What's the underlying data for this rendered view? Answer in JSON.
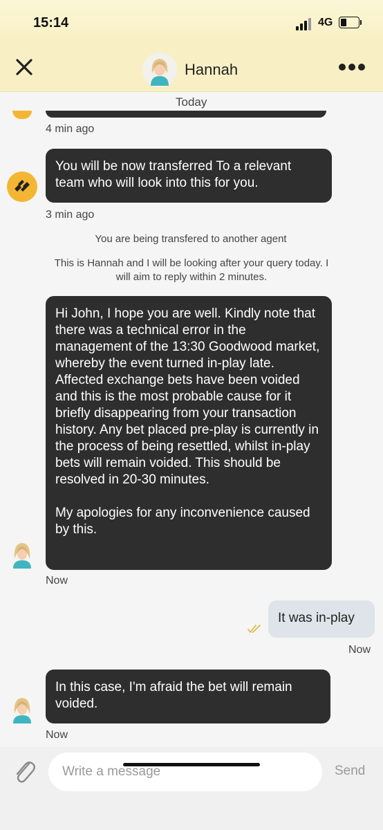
{
  "status": {
    "time": "15:14",
    "network": "4G"
  },
  "header": {
    "title": "Hannah",
    "close_icon": "close-icon",
    "more_icon": "more-dots-icon"
  },
  "date_label": "Today",
  "messages": [
    {
      "from": "system",
      "timestamp": "4 min ago"
    },
    {
      "from": "bot",
      "text": "You will be now transferred To a relevant team who will look into this for you.",
      "timestamp": "3 min ago"
    },
    {
      "from": "system",
      "text": "You are being transfered to another agent"
    },
    {
      "from": "system",
      "text": "This is Hannah and I will be looking after your query today. I will aim to reply within 2 minutes."
    },
    {
      "from": "agent",
      "text": "Hi John, I hope you are well. Kindly note that there was a technical error in the management of the 13:30 Goodwood market, whereby the event turned in-play late. Affected exchange bets have been voided and this is the most probable cause for it briefly disappearing from your transaction history. Any bet placed pre-play is currently in the process of being resettled, whilst in-play bets will remain voided. This should be resolved in 20-30 minutes.\n\nMy apologies for any inconvenience caused by this.",
      "timestamp": "Now"
    },
    {
      "from": "user",
      "text": "It was in-play",
      "timestamp": "Now"
    },
    {
      "from": "agent",
      "text": "In this case, I'm afraid the bet will remain voided.",
      "timestamp": "Now"
    }
  ],
  "composer": {
    "placeholder": "Write a message",
    "send_label": "Send"
  },
  "colors": {
    "header_bg": "#f8f0c4",
    "bubble_dark": "#2e2e2e",
    "bubble_user": "#dfe4ea",
    "bot_badge": "#f4b632"
  }
}
